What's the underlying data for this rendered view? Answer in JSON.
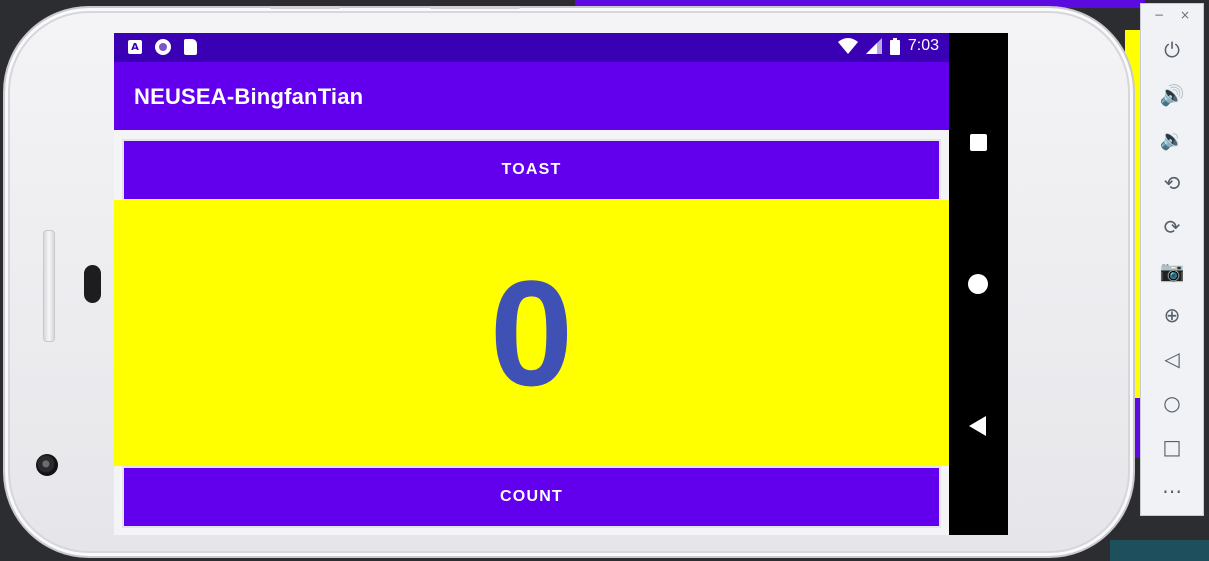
{
  "status_bar": {
    "time": "7:03",
    "icons": [
      "a-notification-icon",
      "circle-notification-icon",
      "sd-card-icon",
      "wifi-icon",
      "signal-icon",
      "battery-icon"
    ]
  },
  "app_bar": {
    "title": "NEUSEA-BingfanTian"
  },
  "buttons": {
    "toast_label": "TOAST",
    "count_label": "COUNT"
  },
  "counter": {
    "value": "0"
  },
  "colors": {
    "primary": "#6200ee",
    "status_bar": "#3a00b3",
    "count_background": "#ffff00",
    "count_text": "#3f51b5"
  },
  "emulator_toolbar": {
    "window_controls": [
      "−",
      "×"
    ],
    "items": [
      {
        "name": "power",
        "glyph": "⏻"
      },
      {
        "name": "volume-up",
        "glyph": "🔊"
      },
      {
        "name": "volume-down",
        "glyph": "🔉"
      },
      {
        "name": "rotate-left",
        "glyph": "⟲"
      },
      {
        "name": "rotate-right",
        "glyph": "⟳"
      },
      {
        "name": "camera",
        "glyph": "📷"
      },
      {
        "name": "zoom",
        "glyph": "⊕"
      },
      {
        "name": "back",
        "glyph": "◁"
      },
      {
        "name": "home",
        "glyph": "○"
      },
      {
        "name": "overview",
        "glyph": "□"
      },
      {
        "name": "more",
        "glyph": "⋯"
      }
    ]
  }
}
